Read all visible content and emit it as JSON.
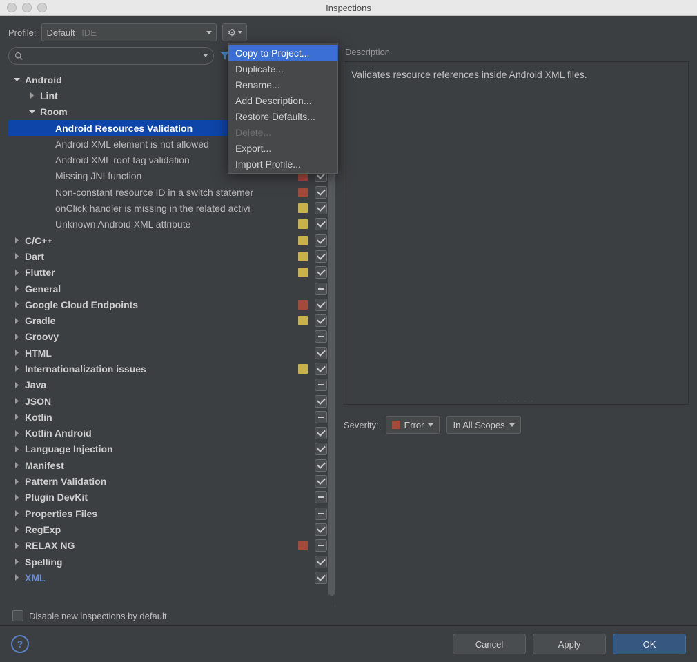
{
  "window_title": "Inspections",
  "profile": {
    "label": "Profile:",
    "value": "Default",
    "suffix": "IDE"
  },
  "search_placeholder": "",
  "menu": {
    "items": [
      {
        "label": "Copy to Project...",
        "selected": true
      },
      {
        "label": "Duplicate..."
      },
      {
        "label": "Rename..."
      },
      {
        "label": "Add Description..."
      },
      {
        "label": "Restore Defaults..."
      },
      {
        "label": "Delete...",
        "disabled": true
      },
      {
        "label": "Export..."
      },
      {
        "label": "Import Profile..."
      }
    ]
  },
  "tree": [
    {
      "level": 0,
      "expanded": true,
      "label": "Android",
      "bold": true
    },
    {
      "level": 1,
      "expanded": false,
      "label": "Lint",
      "bold": true
    },
    {
      "level": 1,
      "expanded": true,
      "label": "Room",
      "bold": true
    },
    {
      "level": 2,
      "label": "Android Resources Validation",
      "bold": true,
      "selected": true
    },
    {
      "level": 2,
      "label": "Android XML element is not allowed"
    },
    {
      "level": 2,
      "label": "Android XML root tag validation",
      "swatch": "yellow",
      "cb": "checked"
    },
    {
      "level": 2,
      "label": "Missing JNI function",
      "swatch": "red",
      "cb": "checked"
    },
    {
      "level": 2,
      "label": "Non-constant resource ID in a switch statemer",
      "swatch": "red",
      "cb": "checked"
    },
    {
      "level": 2,
      "label": "onClick handler is missing in the related activi",
      "swatch": "yellow",
      "cb": "checked"
    },
    {
      "level": 2,
      "label": "Unknown Android XML attribute",
      "swatch": "yellow",
      "cb": "checked"
    },
    {
      "level": 0,
      "expanded": false,
      "label": "C/C++",
      "bold": true,
      "swatch": "yellow",
      "cb": "checked"
    },
    {
      "level": 0,
      "expanded": false,
      "label": "Dart",
      "bold": true,
      "swatch": "yellow",
      "cb": "checked"
    },
    {
      "level": 0,
      "expanded": false,
      "label": "Flutter",
      "bold": true,
      "swatch": "yellow",
      "cb": "checked"
    },
    {
      "level": 0,
      "expanded": false,
      "label": "General",
      "bold": true,
      "cb": "ind"
    },
    {
      "level": 0,
      "expanded": false,
      "label": "Google Cloud Endpoints",
      "bold": true,
      "swatch": "red",
      "cb": "checked"
    },
    {
      "level": 0,
      "expanded": false,
      "label": "Gradle",
      "bold": true,
      "swatch": "yellow",
      "cb": "checked"
    },
    {
      "level": 0,
      "expanded": false,
      "label": "Groovy",
      "bold": true,
      "cb": "ind"
    },
    {
      "level": 0,
      "expanded": false,
      "label": "HTML",
      "bold": true,
      "cb": "checked"
    },
    {
      "level": 0,
      "expanded": false,
      "label": "Internationalization issues",
      "bold": true,
      "swatch": "yellow",
      "cb": "checked"
    },
    {
      "level": 0,
      "expanded": false,
      "label": "Java",
      "bold": true,
      "cb": "ind"
    },
    {
      "level": 0,
      "expanded": false,
      "label": "JSON",
      "bold": true,
      "cb": "checked"
    },
    {
      "level": 0,
      "expanded": false,
      "label": "Kotlin",
      "bold": true,
      "cb": "ind"
    },
    {
      "level": 0,
      "expanded": false,
      "label": "Kotlin Android",
      "bold": true,
      "cb": "checked"
    },
    {
      "level": 0,
      "expanded": false,
      "label": "Language Injection",
      "bold": true,
      "cb": "checked"
    },
    {
      "level": 0,
      "expanded": false,
      "label": "Manifest",
      "bold": true,
      "cb": "checked"
    },
    {
      "level": 0,
      "expanded": false,
      "label": "Pattern Validation",
      "bold": true,
      "cb": "checked"
    },
    {
      "level": 0,
      "expanded": false,
      "label": "Plugin DevKit",
      "bold": true,
      "cb": "ind"
    },
    {
      "level": 0,
      "expanded": false,
      "label": "Properties Files",
      "bold": true,
      "cb": "ind"
    },
    {
      "level": 0,
      "expanded": false,
      "label": "RegExp",
      "bold": true,
      "cb": "checked"
    },
    {
      "level": 0,
      "expanded": false,
      "label": "RELAX NG",
      "bold": true,
      "swatch": "red",
      "cb": "ind"
    },
    {
      "level": 0,
      "expanded": false,
      "label": "Spelling",
      "bold": true,
      "cb": "checked"
    },
    {
      "level": 0,
      "expanded": false,
      "label": "XML",
      "bold": true,
      "cb": "checked",
      "blue": true
    }
  ],
  "disable_new": "Disable new inspections by default",
  "description": {
    "title": "Description",
    "text": "Validates resource references inside Android XML files."
  },
  "severity": {
    "label": "Severity:",
    "value": "Error",
    "scope": "In All Scopes"
  },
  "buttons": {
    "cancel": "Cancel",
    "apply": "Apply",
    "ok": "OK"
  }
}
